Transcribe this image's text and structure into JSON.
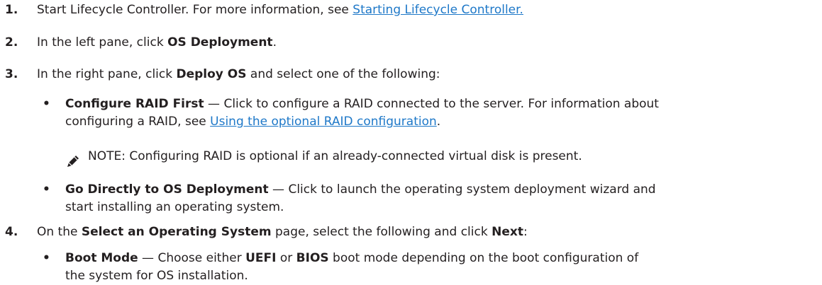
{
  "steps": [
    {
      "number": "1.",
      "text_before": "Start Lifecycle Controller. For more information, see ",
      "link": "Starting Lifecycle Controller."
    },
    {
      "number": "2.",
      "text_before": "In the left pane, click ",
      "bold": "OS Deployment",
      "text_after": "."
    },
    {
      "number": "3.",
      "text_before": "In the right pane, click ",
      "bold": "Deploy OS",
      "text_after": " and select one of the following:",
      "bullets": [
        {
          "bold": "Configure RAID First",
          "text_line1": " — Click to configure a RAID connected to the server. For information about",
          "text_line2": "configuring a RAID, see ",
          "link": "Using the optional RAID configuration",
          "text_after": "."
        },
        {
          "bold": "Go Directly to OS Deployment",
          "text_line1": " — Click to launch the operating system deployment wizard and",
          "text_line2": "start installing an operating system."
        }
      ],
      "note": {
        "icon": "pencil-note-icon",
        "label": "NOTE:",
        "text": " Configuring RAID is optional if an already-connected virtual disk is present."
      }
    },
    {
      "number": "4.",
      "text_before": "On the ",
      "bold": "Select an Operating System",
      "text_middle": " page, select the following and click ",
      "bold2": "Next",
      "text_after": ":",
      "bullets": [
        {
          "bold": "Boot Mode",
          "text_a": " — Choose either ",
          "bold_b": "UEFI",
          "text_c": " or ",
          "bold_d": "BIOS",
          "text_e": " boot mode depending on the boot configuration of",
          "text_line2": "the system for OS installation."
        }
      ]
    }
  ],
  "colors": {
    "text": "#231f20",
    "link": "#1e78c8"
  }
}
